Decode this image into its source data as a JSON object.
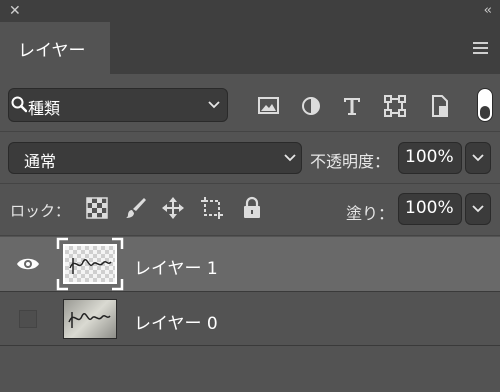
{
  "window": {
    "close_glyph": "✕",
    "collapse_glyph": "‹‹"
  },
  "panel": {
    "tab_label": "レイヤー"
  },
  "filter": {
    "kind_label": "種類"
  },
  "blend": {
    "mode": "通常",
    "opacity_label": "不透明度：",
    "opacity_value": "100%"
  },
  "lock": {
    "label": "ロック：",
    "fill_label": "塗り：",
    "fill_value": "100%"
  },
  "layers": [
    {
      "name": "レイヤー 1",
      "visible": true,
      "selected": true,
      "thumb_text": "Photoshop"
    },
    {
      "name": "レイヤー 0",
      "visible": false,
      "selected": false,
      "thumb_text": "Photoshop"
    }
  ],
  "colors": {
    "panel_bg": "#535353",
    "header_bg": "#3f3f3f",
    "field_bg": "#3b3b3b",
    "selected_row": "#696969",
    "text": "#e6e6e6"
  }
}
